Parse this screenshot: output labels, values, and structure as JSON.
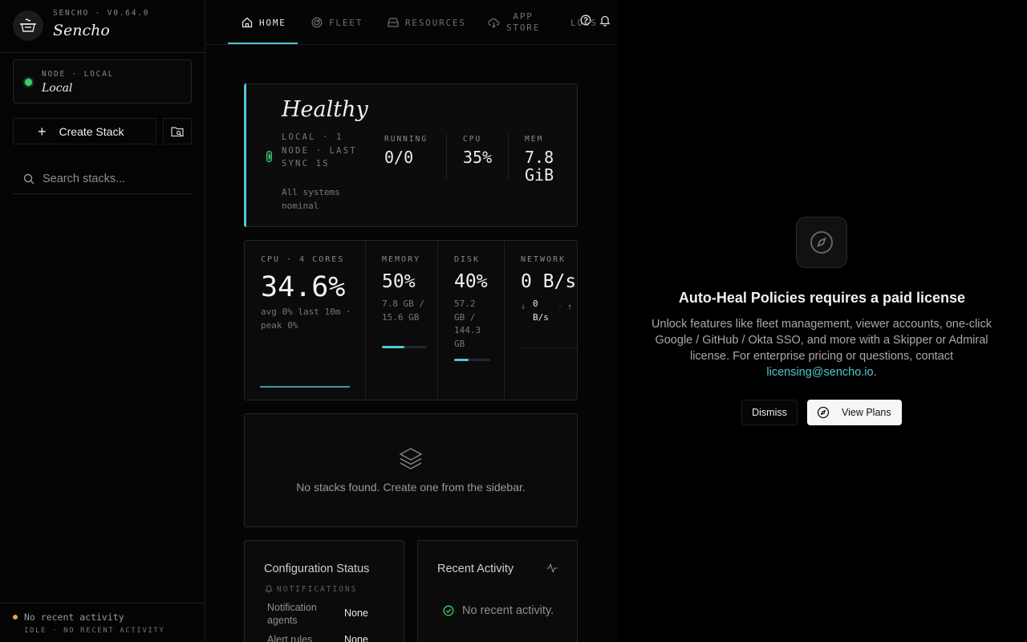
{
  "brand": {
    "version": "SENCHO · V0.64.0",
    "name": "Sencho"
  },
  "node": {
    "label": "NODE · LOCAL",
    "name": "Local",
    "status_color": "#3ccf6e"
  },
  "sidebar": {
    "create_label": "Create Stack",
    "search_placeholder": "Search stacks...",
    "footer": {
      "line1": "No recent activity",
      "line2": "IDLE · NO RECENT ACTIVITY"
    }
  },
  "nav": {
    "tabs": [
      {
        "label": "HOME",
        "icon": "home-icon",
        "active": true
      },
      {
        "label": "FLEET",
        "icon": "radar-icon"
      },
      {
        "label": "RESOURCES",
        "icon": "drive-icon"
      },
      {
        "label": "APP",
        "label2": "STORE",
        "icon": "cloud-download-icon"
      },
      {
        "label": "LOGS",
        "icon": "activity-icon"
      }
    ]
  },
  "health": {
    "title": "Healthy",
    "subtitle": "LOCAL · 1 NODE · LAST SYNC 1S",
    "note": "All systems nominal",
    "stats": [
      {
        "label": "RUNNING",
        "value": "0/0"
      },
      {
        "label": "CPU",
        "value": "35%"
      },
      {
        "label": "MEM",
        "value": "7.8 GiB"
      }
    ]
  },
  "metrics": {
    "cpu": {
      "label": "CPU · 4 CORES",
      "value": "34.6%",
      "sub": "avg 0% last 10m · peak 0%"
    },
    "memory": {
      "label": "MEMORY",
      "value": "50%",
      "sub": "7.8 GB / 15.6 GB",
      "fill": 0.5
    },
    "disk": {
      "label": "DISK",
      "value": "40%",
      "sub": "57.2 GB / 144.3 GB",
      "fill": 0.4
    },
    "network": {
      "label": "NETWORK",
      "value": "0 B/s",
      "down": "0 B/s"
    }
  },
  "stacks": {
    "empty_text": "No stacks found. Create one from the sidebar."
  },
  "config": {
    "title": "Configuration Status",
    "section": "NOTIFICATIONS",
    "rows": [
      {
        "key": "Notification agents",
        "value": "None"
      },
      {
        "key": "Alert rules",
        "value": "None"
      }
    ]
  },
  "activity": {
    "title": "Recent Activity",
    "empty": "No recent activity."
  },
  "paywall": {
    "title": "Auto-Heal Policies requires a paid license",
    "body": "Unlock features like fleet management, viewer accounts, one-click Google / GitHub / Okta SSO, and more with a Skipper or Admiral license. For enterprise pricing or questions, contact",
    "email": "licensing@sencho.io",
    "dismiss": "Dismiss",
    "view_plans": "View Plans"
  },
  "colors": {
    "accent": "#4fc8d0",
    "ok": "#3ccf6e",
    "warn": "#f1a03d"
  }
}
